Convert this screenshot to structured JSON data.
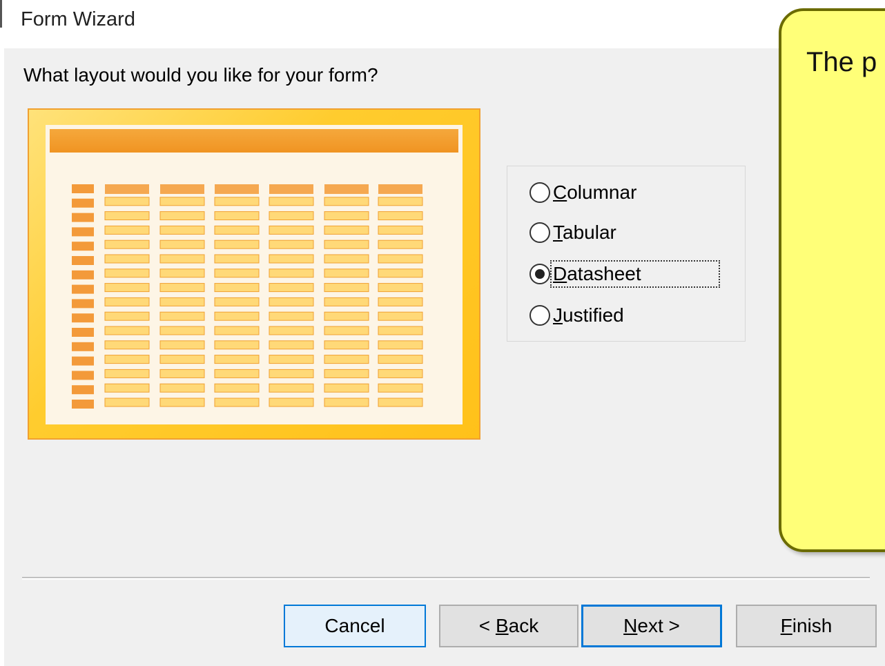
{
  "window": {
    "title": "Form Wizard"
  },
  "prompt": "What layout would you like for your form?",
  "layout_options": [
    {
      "label_accel": "C",
      "label_rest": "olumnar",
      "selected": false
    },
    {
      "label_accel": "T",
      "label_rest": "abular",
      "selected": false
    },
    {
      "label_accel": "D",
      "label_rest": "atasheet",
      "selected": true
    },
    {
      "label_accel": "J",
      "label_rest": "ustified",
      "selected": false
    }
  ],
  "tooltip": {
    "text": "The p"
  },
  "buttons": {
    "cancel": "Cancel",
    "back_prefix": "< ",
    "back_accel": "B",
    "back_rest": "ack",
    "next_accel": "N",
    "next_rest": "ext >",
    "finish_accel": "F",
    "finish_rest": "inish"
  },
  "colors": {
    "preview_frame": "#ffc11a",
    "preview_header": "#f09422",
    "tooltip_bg": "#ffff78",
    "focus_blue": "#0078d7"
  }
}
